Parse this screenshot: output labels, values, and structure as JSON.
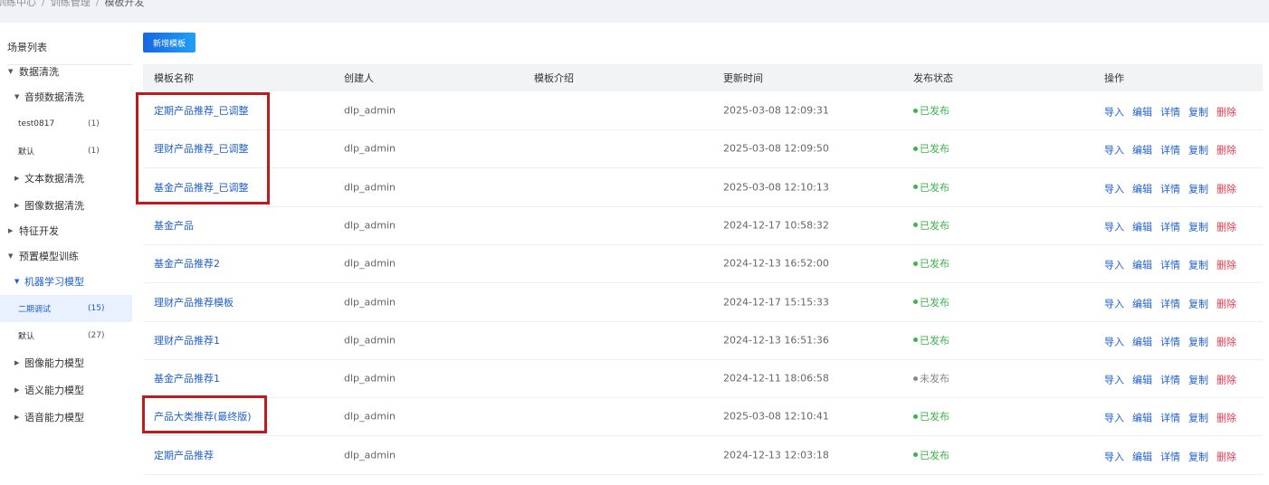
{
  "breadcrumb": [
    "训练中心",
    "训练管理",
    "模板开发"
  ],
  "sidebar": {
    "title": "场景列表",
    "items": [
      {
        "label": "数据清洗",
        "level": 0,
        "caret": "down"
      },
      {
        "label": "音频数据清洗",
        "level": 1,
        "caret": "down"
      },
      {
        "label": "test0817",
        "level": 2,
        "count": "(1)"
      },
      {
        "label": "默认",
        "level": 2,
        "count": "(1)"
      },
      {
        "label": "文本数据清洗",
        "level": 1,
        "caret": "right"
      },
      {
        "label": "图像数据清洗",
        "level": 1,
        "caret": "right"
      },
      {
        "label": "特征开发",
        "level": 0,
        "caret": "right"
      },
      {
        "label": "预置模型训练",
        "level": 0,
        "caret": "down"
      },
      {
        "label": "机器学习模型",
        "level": 1,
        "caret": "down",
        "highlight": true
      },
      {
        "label": "二期调试",
        "level": 2,
        "count": "(15)",
        "active": true
      },
      {
        "label": "默认",
        "level": 2,
        "count": "(27)"
      },
      {
        "label": "图像能力模型",
        "level": 1,
        "caret": "right"
      },
      {
        "label": "语义能力模型",
        "level": 1,
        "caret": "right"
      },
      {
        "label": "语音能力模型",
        "level": 1,
        "caret": "right"
      }
    ]
  },
  "toolbar": {
    "add_label": "新增模板"
  },
  "table": {
    "headers": {
      "name": "模板名称",
      "creator": "创建人",
      "intro": "模板介绍",
      "time": "更新时间",
      "status": "发布状态",
      "ops": "操作"
    },
    "op_labels": {
      "import": "导入",
      "edit": "编辑",
      "detail": "详情",
      "copy": "复制",
      "delete": "删除"
    },
    "rows": [
      {
        "name": "定期产品推荐_已调整",
        "creator": "dlp_admin",
        "intro": "",
        "time": "2025-03-08 12:09:31",
        "status": "已发布",
        "published": true
      },
      {
        "name": "理财产品推荐_已调整",
        "creator": "dlp_admin",
        "intro": "",
        "time": "2025-03-08 12:09:50",
        "status": "已发布",
        "published": true
      },
      {
        "name": "基金产品推荐_已调整",
        "creator": "dlp_admin",
        "intro": "",
        "time": "2025-03-08 12:10:13",
        "status": "已发布",
        "published": true
      },
      {
        "name": "基金产品",
        "creator": "dlp_admin",
        "intro": "",
        "time": "2024-12-17 10:58:32",
        "status": "已发布",
        "published": true
      },
      {
        "name": "基金产品推荐2",
        "creator": "dlp_admin",
        "intro": "",
        "time": "2024-12-13 16:52:00",
        "status": "已发布",
        "published": true
      },
      {
        "name": "理财产品推荐模板",
        "creator": "dlp_admin",
        "intro": "",
        "time": "2024-12-17 15:15:33",
        "status": "已发布",
        "published": true
      },
      {
        "name": "理财产品推荐1",
        "creator": "dlp_admin",
        "intro": "",
        "time": "2024-12-13 16:51:36",
        "status": "已发布",
        "published": true
      },
      {
        "name": "基金产品推荐1",
        "creator": "dlp_admin",
        "intro": "",
        "time": "2024-12-11 18:06:58",
        "status": "未发布",
        "published": false
      },
      {
        "name": "产品大类推荐(最终版)",
        "creator": "dlp_admin",
        "intro": "",
        "time": "2025-03-08 12:10:41",
        "status": "已发布",
        "published": true
      },
      {
        "name": "定期产品推荐",
        "creator": "dlp_admin",
        "intro": "",
        "time": "2024-12-13 12:03:18",
        "status": "已发布",
        "published": true
      }
    ]
  },
  "colors": {
    "accent": "#1f5fcc",
    "published": "#3bb44a",
    "unpublished": "#888888",
    "delete": "#e8384a",
    "highlight_box": "#c0191e"
  }
}
